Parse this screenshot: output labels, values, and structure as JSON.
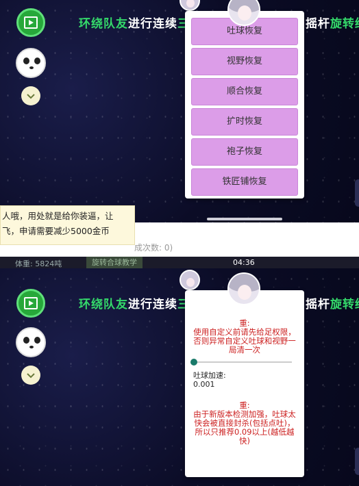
{
  "banner": {
    "top": {
      "part1": "环绕队友",
      "part2": "进行连续",
      "part3": "三",
      "part4": "摇杆",
      "part5": "旋转结"
    },
    "bottom": {
      "part1": "环绕队友",
      "part2": "进行连续",
      "part3": "三",
      "part4": "摇杆",
      "part5": "旋转结"
    }
  },
  "recovery_menu": {
    "items": [
      "吐球恢复",
      "视野恢复",
      "顺合恢复",
      "扩时恢复",
      "袍子恢复",
      "铁匠铺恢复"
    ]
  },
  "tooltip": {
    "line1": "人哦，用处就是给你装逼，让",
    "line2": "飞，申请需要减少5000金币"
  },
  "count_text": "成次数: 0)",
  "status": {
    "time": "04:36",
    "weight": "体重: 5824吨",
    "teach_button": "旋转合球教学"
  },
  "settings_popup": {
    "note_title": "重:",
    "note_text": "使用自定义前请先给足权限，否则异常自定义吐球和视野一局清一次",
    "spit_speed_label": "吐球加速:",
    "spit_speed_value": "0.001",
    "spit_speed_slider": 0.0,
    "warning_title": "重:",
    "warning_text": "由于新版本检测加强，吐球太快会被直接封杀(包括点吐)，所以只推荐0.09以上(越低越快)"
  },
  "colors": {
    "menu_button": "#dc9de8",
    "warning": "#cc1f1f",
    "banner_green": "#34d96a"
  }
}
